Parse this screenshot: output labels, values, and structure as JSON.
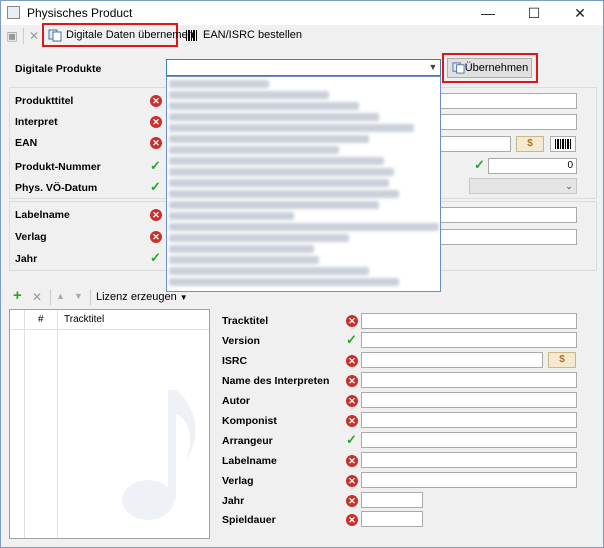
{
  "window": {
    "title": "Physisches Product",
    "minimize_glyph": "—",
    "maximize_glyph": "☐",
    "close_glyph": "✕"
  },
  "toolbar": {
    "digital_data_label": "Digitale Daten übernemen",
    "ean_label": "EAN/ISRC bestellen"
  },
  "top": {
    "digitale_produkte_label": "Digitale Produkte",
    "ubernehmen_label": "Übernehmen"
  },
  "fields": {
    "produkttitel": "Produkttitel",
    "interpret": "Interpret",
    "ean": "EAN",
    "produkt_nummer": "Produkt-Nummer",
    "phys_vo_datum": "Phys. VÖ-Datum",
    "labelname": "Labelname",
    "verlag": "Verlag",
    "jahr": "Jahr",
    "numeric_value": "0",
    "dollar": "$"
  },
  "track_toolbar": {
    "lizenz_label": "Lizenz erzeugen"
  },
  "track_table": {
    "col_hash": "#",
    "col_tracktitel": "Tracktitel"
  },
  "track_fields": {
    "tracktitel": "Tracktitel",
    "version": "Version",
    "isrc": "ISRC",
    "name_des_interpreten": "Name des Interpreten",
    "autor": "Autor",
    "komponist": "Komponist",
    "arrangeur": "Arrangeur",
    "labelname": "Labelname",
    "verlag": "Verlag",
    "jahr": "Jahr",
    "spieldauer": "Spieldauer"
  },
  "colors": {
    "error": "#c9302c",
    "ok": "#2aa32a",
    "highlight": "#e0151b"
  }
}
